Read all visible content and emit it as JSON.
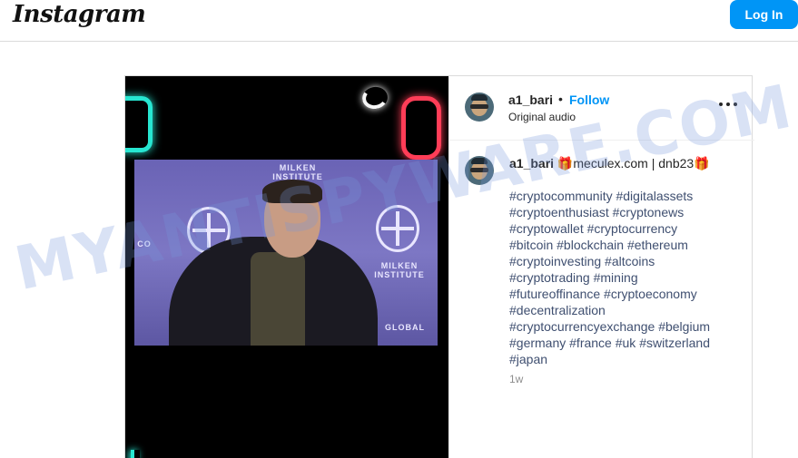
{
  "header": {
    "logo": "Instagram",
    "login_label": "Log In"
  },
  "post": {
    "author": {
      "username": "a1_bari",
      "separator": "•",
      "follow_label": "Follow",
      "audio_label": "Original audio"
    },
    "media": {
      "watermark_line1": "MILKEN",
      "watermark_line2": "INSTITUTE",
      "watermark_right": "GLOBAL",
      "watermark_left": "CO"
    },
    "caption": {
      "username": "a1_bari",
      "text": " 🎁meculex.com | dnb23🎁",
      "hashtag_lines": [
        "#cryptocommunity #digitalassets",
        "#cryptoenthusiast #cryptonews",
        "#cryptowallet #cryptocurrency",
        "#bitcoin #blockchain #ethereum",
        "#cryptoinvesting #altcoins",
        "#cryptotrading #mining",
        "#futureoffinance #cryptoeconomy",
        "#decentralization",
        "#cryptocurrencyexchange #belgium",
        "#germany #france #uk #switzerland",
        "#japan"
      ],
      "time": "1w"
    }
  },
  "overlay": {
    "watermark": "MYANTISPYWARE.COM"
  },
  "colors": {
    "accent": "#0095f6",
    "border": "#dbdbdb",
    "hashtag": "#3f4f70"
  }
}
